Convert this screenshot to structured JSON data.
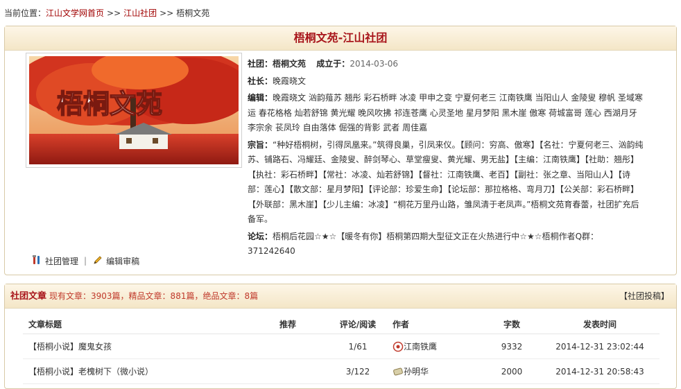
{
  "breadcrumb": {
    "prefix": "当前位置：",
    "home": "江山文学网首页",
    "sep": ">>",
    "club": "江山社团",
    "current": "梧桐文苑"
  },
  "club": {
    "header_title": "梧桐文苑-江山社团",
    "cover_text": "梧桐文苑",
    "labels": {
      "club": "社团：",
      "founded": "成立于：",
      "president": "社长：",
      "editors": "编辑：",
      "mission": "宗旨：",
      "forum": "论坛："
    },
    "name": "梧桐文苑",
    "founded": "2014-03-06",
    "president": "晚霞晓文",
    "editors": "晚霞晓文 汹韵薤苏 翘彤 彩石桥畔 冰凌 甲申之变 宁夏何老三 江南铁鹰 当阳山人 金陵叟 穆帆 圣域寒运 春花格格 灿若舒锦 黄光耀 晚风吹拂 祁连苍鹰 心灵圣地 星月梦阳 黑木崖 傲寒 荷城富哥 莲心 西湖月牙 李宗余 苌凤玲 自由落体 倔强的背影 武者 周佳嘉",
    "mission": "“种好梧桐树，引得凤凰来。”筑得良巢，引凤来仪。【顾问：穷高、傲寒】【名社：宁夏何老三、汹韵纯苏、铺路石、冯耀廷、金陵叟、醉剑琴心、草堂瘦叟、黄光耀、男无盐】【主编：江南铁鹰】【社助：翘彤】【执社：彩石桥畔】【常社：冰凌、灿若舒锦】【督社：江南铁鹰、老百】【副社：张之章、当阳山人】【诗部：莲心】【散文部：星月梦阳】【评论部：珍爱生命】【论坛部：那拉格格、弯月刀】【公关部：彩石桥畔】【外联部：黑木崖】【少儿主编：冰凌】“桐花万里丹山路，雏凤清于老凤声。”梧桐文苑育春蕾，社团扩充后备军。",
    "forum": "梧桐后花园☆★☆【暖冬有你】梧桐第四期大型征文正在火热进行中☆★☆梧桐作者Q群：371242640"
  },
  "actions": {
    "manage": "社团管理",
    "divider": "|",
    "review": "编辑审稿"
  },
  "articles": {
    "title": "社团文章",
    "stats": "现有文章：3903篇，精品文章：881篇，绝品文章：8篇",
    "submit": "【社团投稿】",
    "columns": [
      "文章标题",
      "推荐",
      "评论/阅读",
      "作者",
      "字数",
      "发表时间"
    ],
    "rows": [
      {
        "title": "【梧桐小说】魔鬼女孩",
        "rec": "",
        "rr": "1/61",
        "author": "江南铁鹰",
        "words": "9332",
        "time": "2014-12-31 23:02:44"
      },
      {
        "title": "【梧桐小说】老槐树下（微小说）",
        "rec": "",
        "rr": "3/122",
        "author": "孙明华",
        "words": "2000",
        "time": "2014-12-31 20:58:43"
      }
    ]
  },
  "colors": {
    "accent": "#a8151b",
    "link": "#a00000",
    "stats": "#c0392b",
    "panel_bg": "#f4e6c7",
    "border": "#d8c9a7"
  },
  "icons": [
    "tools-icon",
    "pencil-icon",
    "author-badge-icon",
    "author-scroll-icon"
  ]
}
